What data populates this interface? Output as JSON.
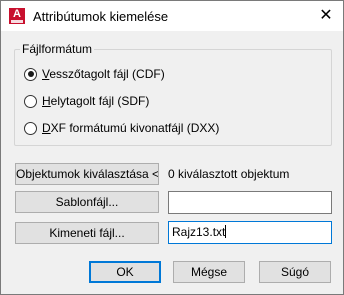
{
  "window": {
    "title": "Attribútumok kiemelése",
    "close_symbol": "✕"
  },
  "file_format": {
    "legend": "Fájlformátum",
    "options": [
      {
        "label": "Vesszőtagolt fájl (CDF)",
        "accel": "V",
        "rest": "esszőtagolt fájl (CDF)",
        "checked": true
      },
      {
        "label": "Helytagolt fájl (SDF)",
        "accel": "H",
        "rest": "elytagolt fájl (SDF)",
        "checked": false
      },
      {
        "label": "DXF formátumú kivonatfájl (DXX)",
        "accel": "D",
        "rest": "XF formátumú kivonatfájl (DXX)",
        "checked": false
      }
    ]
  },
  "selection": {
    "button_label": "Objektumok kiválasztása <",
    "status": "0 kiválasztott objektum"
  },
  "template": {
    "button_label": "Sablonfájl...",
    "value": ""
  },
  "output": {
    "button_label": "Kimeneti fájl...",
    "value": "Rajz13.txt"
  },
  "footer": {
    "ok_label": "OK",
    "cancel_label": "Mégse",
    "help_label": "Súgó"
  }
}
